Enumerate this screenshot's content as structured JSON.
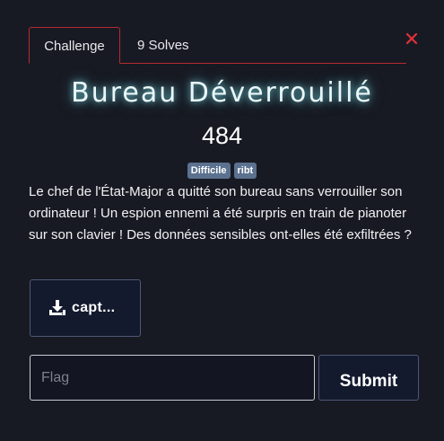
{
  "tabs": [
    {
      "label": "Challenge",
      "active": true
    },
    {
      "label": "9 Solves",
      "active": false
    }
  ],
  "close_icon": "close-icon",
  "challenge": {
    "title": "Bureau Déverrouillé",
    "points": "484",
    "tags": [
      "Difficile",
      "ribt"
    ],
    "description": "Le chef de l'État-Major a quitté son bureau sans verrouiller son ordinateur ! Un espion ennemi a été surpris en train de pianoter sur son clavier ! Des données sensibles ont-elles été exfiltrées ?"
  },
  "file": {
    "label": "capt...",
    "icon": "download-icon"
  },
  "flag_form": {
    "placeholder": "Flag",
    "value": "",
    "submit_label": "Submit"
  },
  "colors": {
    "accent": "#b72a2f",
    "close": "#e0323a",
    "badge": "#5b718f",
    "title_glow": "#82e6f0",
    "background": "#181a23"
  }
}
